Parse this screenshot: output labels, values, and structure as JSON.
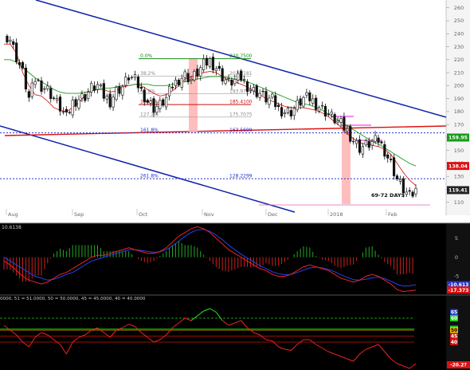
{
  "chart_data": {
    "type": "candlestick",
    "price_panel": {
      "ylim": [
        100,
        266
      ],
      "y_ticks": [
        110,
        120,
        130,
        140,
        150,
        160,
        170,
        180,
        190,
        200,
        210,
        220,
        230,
        240,
        250,
        260
      ],
      "x_tick_labels": [
        "Aug",
        "Sep",
        "Oct",
        "Nov",
        "Dec",
        "2018",
        "Feb"
      ],
      "price_tags": [
        {
          "value": "159.95",
          "num": 159.95,
          "color": "#1a9a1a"
        },
        {
          "value": "138.04",
          "num": 138.04,
          "color": "#dd1111"
        },
        {
          "value": "119.41",
          "num": 119.41,
          "color": "#222222"
        }
      ],
      "annotation": "69-72 DAYS",
      "fib_levels": [
        {
          "pct": "0.0%",
          "price": "220.7500",
          "num": 220.75,
          "color": "#1a8a1a"
        },
        {
          "pct": "38.2%",
          "price": "207.2181",
          "num": 207.2,
          "color": "#888888"
        },
        {
          "pct": "61.8%",
          "price": "193.9750",
          "num": 193.6,
          "color": "#888888"
        },
        {
          "pct": "100.0%",
          "price": "185.4100",
          "num": 185.41,
          "color": "#cc1111"
        },
        {
          "pct": "127.2%",
          "price": "175.7075",
          "num": 175.7,
          "color": "#888888"
        },
        {
          "pct": "161.8%",
          "price": "163.5699",
          "num": 163.57,
          "color": "#2233cc"
        },
        {
          "pct": "261.8%",
          "price": "128.2299",
          "num": 128.23,
          "color": "#2233cc"
        }
      ],
      "series": [
        {
          "name": "Price",
          "values": [
            240,
            236,
            222,
            210,
            190,
            205,
            200,
            197,
            190,
            183,
            175,
            187,
            190,
            192,
            198,
            200,
            192,
            188,
            196,
            199,
            207,
            204,
            196,
            188,
            183,
            185,
            190,
            200,
            205,
            208,
            205,
            210,
            216,
            219,
            214,
            207,
            202,
            204,
            206,
            200,
            196,
            194,
            190,
            189,
            182,
            180,
            180,
            185,
            190,
            190,
            186,
            182,
            178,
            174,
            170,
            165,
            158,
            152,
            154,
            156,
            158,
            150,
            140,
            128,
            120,
            114,
            119
          ]
        },
        {
          "name": "",
          "values": [
            232,
            232,
            225,
            210,
            200,
            193,
            192,
            188,
            183,
            181,
            180,
            183,
            187,
            192,
            196,
            197,
            197,
            195,
            196,
            199,
            200,
            201,
            200,
            197,
            194,
            192,
            193,
            196,
            200,
            205,
            207,
            208,
            210,
            211,
            210,
            207,
            204,
            203,
            201,
            199,
            196,
            193,
            190,
            188,
            186,
            184,
            183,
            183,
            183,
            182,
            181,
            179,
            176,
            172,
            168,
            163,
            159,
            156,
            155,
            154,
            153,
            151,
            147,
            140,
            133,
            127,
            123
          ]
        },
        {
          "name": "",
          "values": [
            220,
            220,
            218,
            214,
            210,
            206,
            203,
            200,
            197,
            195,
            194,
            194,
            194,
            195,
            196,
            197,
            198,
            198,
            199,
            200,
            200,
            201,
            201,
            201,
            200,
            200,
            200,
            201,
            202,
            203,
            204,
            205,
            206,
            207,
            207,
            207,
            206,
            205,
            204,
            203,
            201,
            199,
            197,
            195,
            193,
            191,
            189,
            187,
            186,
            185,
            183,
            181,
            178,
            175,
            172,
            169,
            166,
            163,
            160,
            157,
            155,
            152,
            149,
            146,
            143,
            140,
            138
          ]
        }
      ]
    },
    "macd_panel": {
      "header": "10.6138",
      "ylim": [
        -9.5,
        8.5
      ],
      "y_ticks": [
        "5",
        "0",
        "-5"
      ],
      "y_tick_values": [
        5,
        0,
        -5
      ],
      "price_tags": [
        {
          "value": "-10.613",
          "num": -7.2,
          "color": "#2233cc"
        },
        {
          "value": "-17.373",
          "num": -8.6,
          "color": "#dd1111"
        }
      ],
      "series": [
        {
          "name": "",
          "values": [
            -1,
            -2,
            -3.5,
            -5,
            -6,
            -6.5,
            -7,
            -6.5,
            -5.5,
            -4.5,
            -4,
            -3,
            -2,
            -1,
            0,
            0.5,
            0.5,
            1,
            1.5,
            2,
            2.5,
            2,
            1.5,
            1,
            1,
            1.5,
            2.5,
            4,
            5.5,
            6.5,
            7.5,
            8,
            7.5,
            6.5,
            5,
            3.5,
            2,
            1,
            0,
            -1,
            -2,
            -3,
            -3.5,
            -4.5,
            -5,
            -5,
            -4.5,
            -3.5,
            -2.5,
            -2,
            -2.5,
            -3,
            -3.5,
            -4.5,
            -5.5,
            -6,
            -6.5,
            -6,
            -5,
            -4.5,
            -5,
            -6,
            -7,
            -8.5,
            -9,
            -8.8,
            -8.6
          ]
        },
        {
          "name": "",
          "values": [
            0,
            -1,
            -2,
            -3,
            -4,
            -5,
            -5.5,
            -6,
            -5.8,
            -5.2,
            -4.5,
            -4,
            -3,
            -2,
            -1,
            -0.5,
            0,
            0.5,
            1,
            1.5,
            2,
            2,
            1.8,
            1.5,
            1.3,
            1.4,
            2,
            3,
            4.2,
            5.5,
            6.5,
            7.2,
            7.3,
            6.8,
            5.8,
            4.6,
            3.2,
            2,
            0.8,
            -0.2,
            -1.2,
            -2.2,
            -3,
            -3.8,
            -4.3,
            -4.6,
            -4.5,
            -4,
            -3.4,
            -2.8,
            -2.6,
            -2.8,
            -3.2,
            -3.8,
            -4.6,
            -5.3,
            -5.9,
            -6,
            -5.8,
            -5.4,
            -5.2,
            -5.6,
            -6.3,
            -7.1,
            -7.6,
            -7.5,
            -7.2
          ]
        }
      ]
    },
    "rsi_panel": {
      "legend_text": "0000, 51 = 51.0000, 50 = 50.0000, 45 = 45.0000, 40 = 40.0000",
      "ylim": [
        18,
        78
      ],
      "levels": [
        {
          "value": "65",
          "num": 65,
          "color": "#2233cc"
        },
        {
          "value": "60",
          "num": 60,
          "color": "#22cc22"
        },
        {
          "value": "51",
          "num": 51,
          "color": "#22cc22"
        },
        {
          "value": "50",
          "num": 50,
          "color": "#e6c200"
        },
        {
          "value": "45",
          "num": 45,
          "color": "#cc1111"
        },
        {
          "value": "40",
          "num": 40,
          "color": "#cc1111"
        }
      ],
      "current_tag": {
        "value": "-20.2?",
        "num": 21,
        "color": "#dd1111"
      },
      "series": [
        {
          "name": "",
          "values": [
            54,
            50,
            46,
            40,
            36,
            44,
            48,
            46,
            42,
            38,
            30,
            40,
            44,
            46,
            50,
            52,
            48,
            44,
            50,
            52,
            55,
            53,
            48,
            44,
            40,
            42,
            46,
            52,
            56,
            60,
            58,
            62,
            66,
            68,
            65,
            58,
            54,
            56,
            58,
            52,
            48,
            46,
            42,
            41,
            36,
            34,
            33,
            38,
            42,
            42,
            38,
            35,
            32,
            30,
            28,
            26,
            24,
            30,
            34,
            36,
            38,
            32,
            26,
            22,
            20,
            18,
            22
          ]
        }
      ]
    }
  }
}
